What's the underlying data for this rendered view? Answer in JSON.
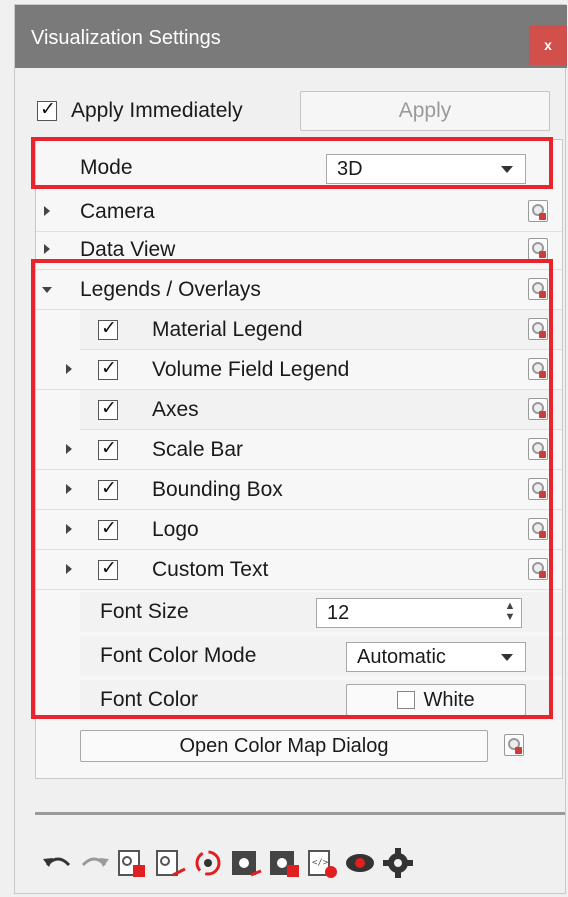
{
  "window": {
    "title": "Visualization Settings",
    "close_glyph": "x"
  },
  "apply": {
    "checked": true,
    "immediately_label": "Apply Immediately",
    "button_label": "Apply"
  },
  "mode": {
    "label": "Mode",
    "value": "3D"
  },
  "sections": {
    "camera": "Camera",
    "data_view": "Data View",
    "legends": "Legends / Overlays"
  },
  "legend_items": [
    {
      "label": "Material Legend",
      "checked": true,
      "expandable": false
    },
    {
      "label": "Volume Field Legend",
      "checked": true,
      "expandable": true
    },
    {
      "label": "Axes",
      "checked": true,
      "expandable": false
    },
    {
      "label": "Scale Bar",
      "checked": true,
      "expandable": true
    },
    {
      "label": "Bounding Box",
      "checked": true,
      "expandable": true
    },
    {
      "label": "Logo",
      "checked": true,
      "expandable": true
    },
    {
      "label": "Custom Text",
      "checked": true,
      "expandable": true
    }
  ],
  "font": {
    "size_label": "Font Size",
    "size_value": "12",
    "color_mode_label": "Font Color Mode",
    "color_mode_value": "Automatic",
    "color_label": "Font Color",
    "color_value": "White"
  },
  "open_color_map_label": "Open Color Map Dialog",
  "toolbar_icons": [
    "undo-icon",
    "redo-icon",
    "copy-settings-icon",
    "paste-settings-icon",
    "reset-icon",
    "save-preset-icon",
    "load-preset-icon",
    "export-settings-icon",
    "visibility-icon",
    "settings-gear-icon"
  ],
  "colors": {
    "highlight": "#e8242c",
    "titlebar": "#7a7a7a",
    "close": "#d2504b"
  }
}
